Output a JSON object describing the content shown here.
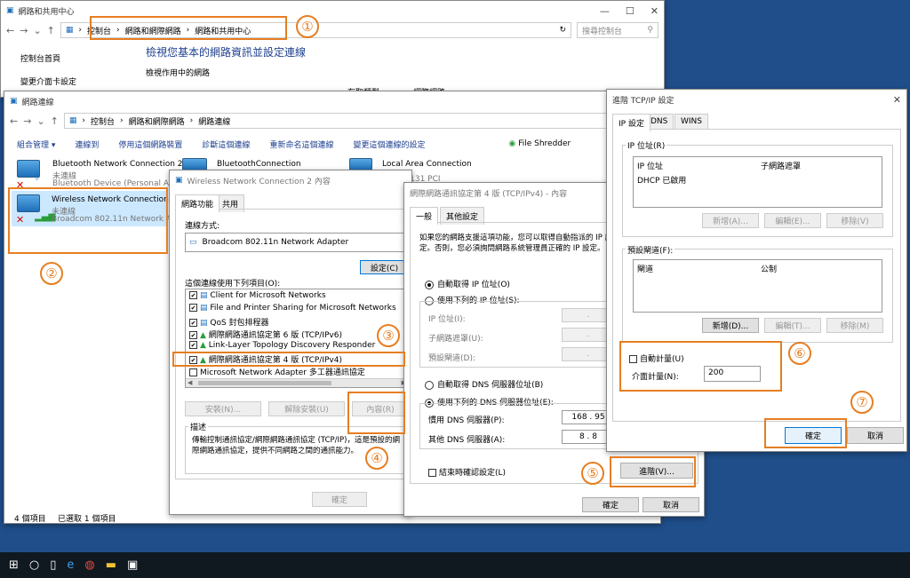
{
  "w1": {
    "title": "網路和共用中心",
    "breadcrumb": [
      "控制台",
      "網路和網際網路",
      "網路和共用中心"
    ],
    "search_placeholder": "搜尋控制台",
    "heading": "檢視您基本的網路資訊並設定連線",
    "subheading": "檢視作用中的網路",
    "side_home": "控制台首頁",
    "side_adapter": "變更介面卡設定",
    "access_type_label": "存取類型:",
    "internet": "網際網路"
  },
  "w2": {
    "title": "網路連線",
    "breadcrumb": [
      "控制台",
      "網路和網際網路",
      "網路連線"
    ],
    "search_placeholder": "搜尋 網路連線",
    "toolbar": [
      "組合管理 ▾",
      "連線到",
      "停用這個網路裝置",
      "診斷這個連線",
      "重新命名這個連線",
      "變更這個連線的設定"
    ],
    "file_shredder": "File Shredder",
    "conn1": {
      "name": "Bluetooth Network Connection 2",
      "status": "未連線",
      "device": "Bluetooth Device (Personal Are"
    },
    "conn2": {
      "name": "BluetoothConnection"
    },
    "conn3": {
      "name": "Local Area Connection"
    },
    "conn4": {
      "name": "Wireless Network Connection 2",
      "status": "未連線",
      "device": "Broadcom 802.11n Network Ad"
    },
    "conn5_device": "AR8131 PCI",
    "status_count": "4 個項目",
    "status_selected": "已選取 1 個項目"
  },
  "w3": {
    "title": "Wireless Network Connection 2 內容",
    "tabs": [
      "網路功能",
      "共用"
    ],
    "connect_using_label": "連線方式:",
    "adapter": "Broadcom 802.11n Network Adapter",
    "configure_btn": "設定(C)",
    "items_label": "這個連線使用下列項目(O):",
    "items": [
      {
        "label": "Client for Microsoft Networks",
        "check": "✔"
      },
      {
        "label": "File and Printer Sharing for Microsoft Networks",
        "check": "✔"
      },
      {
        "label": "QoS 封包排程器",
        "check": "✔"
      },
      {
        "label": "網際網路通訊協定第 6 版 (TCP/IPv6)",
        "check": "✔"
      },
      {
        "label": "Link-Layer Topology Discovery Responder",
        "check": "✔"
      },
      {
        "label": "網際網路通訊協定第 4 版 (TCP/IPv4)",
        "check": "✔"
      },
      {
        "label": "Microsoft Network Adapter 多工器通訊協定",
        "check": ""
      }
    ],
    "install_btn": "安裝(N)...",
    "uninstall_btn": "解除安裝(U)",
    "properties_btn": "內容(R)",
    "desc_label": "描述",
    "desc_text": "傳輸控制通訊協定/網際網路通訊協定 (TCP/IP)，這是預設的網際網路通訊協定，提供不同網路之間的通訊能力。",
    "ok_btn": "確定"
  },
  "w4": {
    "title": "網際網路通訊協定第 4 版 (TCP/IPv4) - 內容",
    "tabs": [
      "一般",
      "其他設定"
    ],
    "intro": "如果您的網路支援這項功能，您可以取得自動指派的 IP 設定。否則，您必須詢問網路系統管理員正確的 IP 設定。",
    "auto_ip": "自動取得 IP 位址(O)",
    "manual_ip": "使用下列的 IP 位址(S):",
    "ip_label": "IP 位址(I):",
    "mask_label": "子網路遮罩(U):",
    "gw_label": "預設閘道(D):",
    "auto_dns": "自動取得 DNS 伺服器位址(B)",
    "manual_dns": "使用下列的 DNS 伺服器位址(E):",
    "pref_dns_label": "慣用 DNS 伺服器(P):",
    "pref_dns": "168 . 95",
    "alt_dns_label": "其他 DNS 伺服器(A):",
    "alt_dns": "8 . 8",
    "validate": "結束時確認設定(L)",
    "advanced_btn": "進階(V)...",
    "ok_btn": "確定",
    "cancel_btn": "取消"
  },
  "w5": {
    "title": "進階 TCP/IP 設定",
    "tabs": [
      "IP 設定",
      "DNS",
      "WINS"
    ],
    "ip_group": "IP 位址(R)",
    "col_ip": "IP 位址",
    "col_mask": "子網路遮罩",
    "dhcp": "DHCP 已啟用",
    "add_btn": "新增(A)...",
    "edit_btn": "編輯(E)...",
    "remove_btn": "移除(V)",
    "gw_group": "預設閘道(F):",
    "col_gw": "閘道",
    "col_metric": "公制",
    "add_btn2": "新增(D)...",
    "edit_btn2": "編輯(T)...",
    "remove_btn2": "移除(M)",
    "auto_metric": "自動計量(U)",
    "metric_label": "介面計量(N):",
    "metric_value": "200",
    "ok_btn": "確定",
    "cancel_btn": "取消"
  },
  "steps": [
    "①",
    "②",
    "③",
    "④",
    "⑤",
    "⑥",
    "⑦"
  ],
  "colors": {
    "annotation": "#e67e22",
    "taskbar": "#101820"
  }
}
